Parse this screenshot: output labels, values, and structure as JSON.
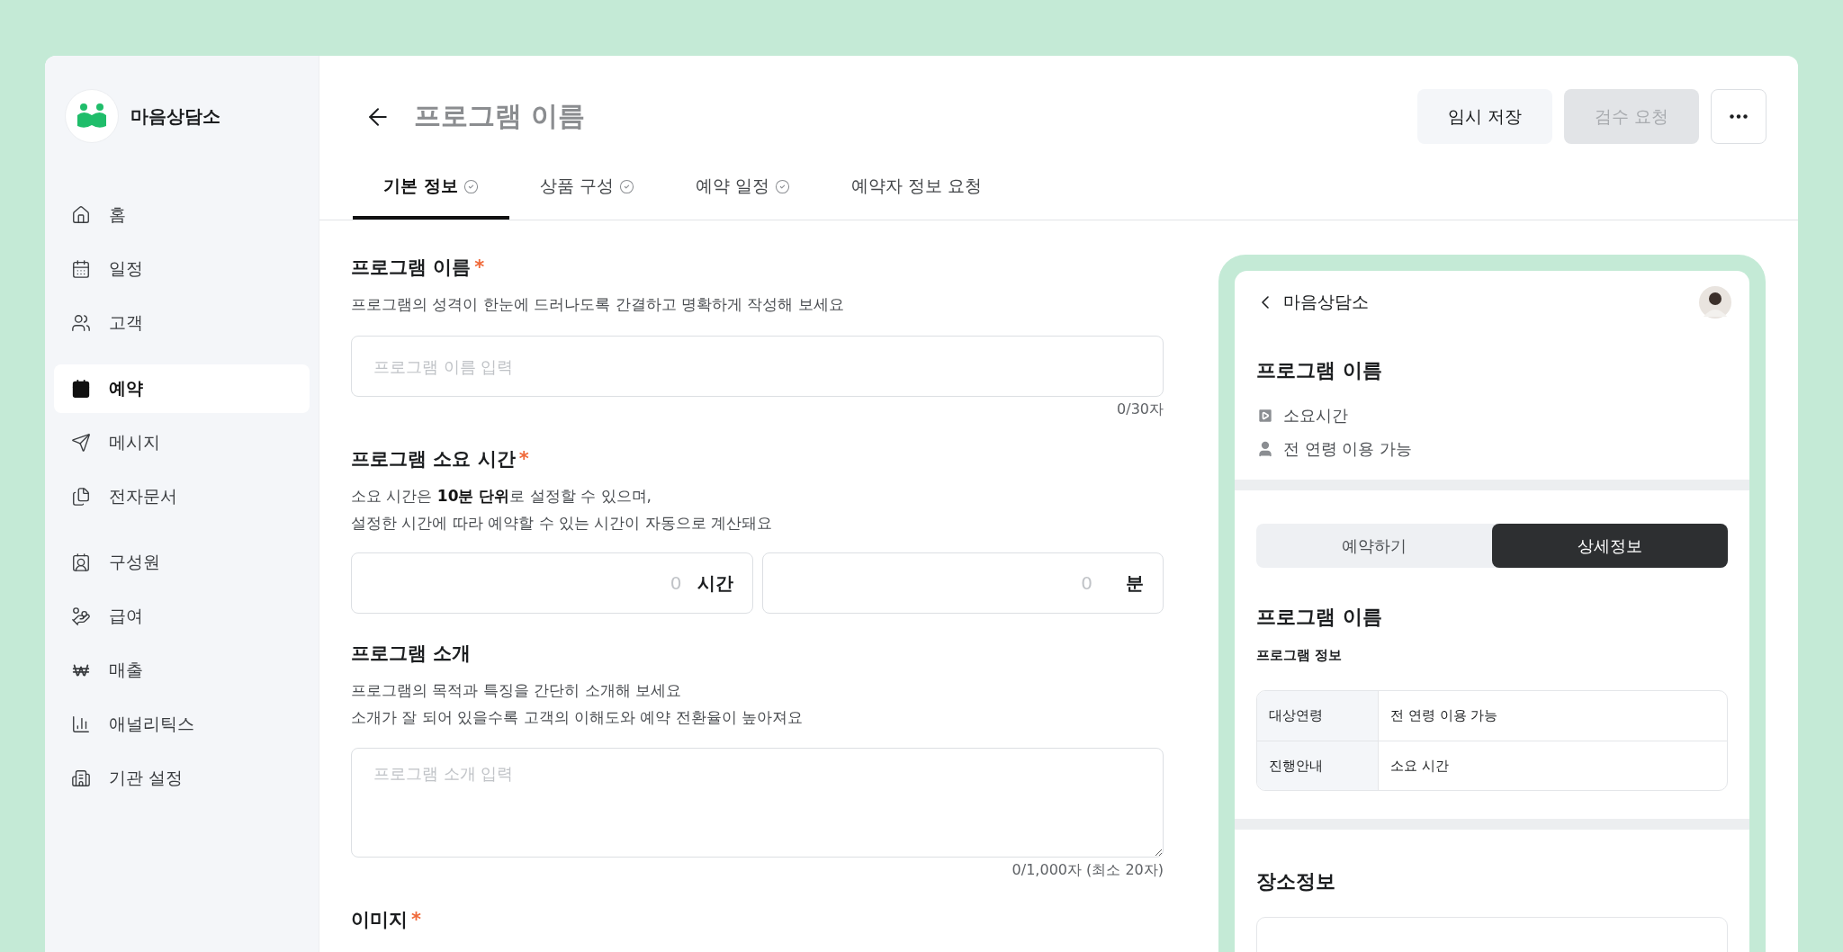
{
  "sidebar": {
    "brand": "마음상담소",
    "groups": [
      [
        {
          "label": "홈",
          "kind": "home",
          "selected": false
        },
        {
          "label": "일정",
          "kind": "schedule",
          "selected": false
        },
        {
          "label": "고객",
          "kind": "clients",
          "selected": false
        }
      ],
      [
        {
          "label": "예약",
          "kind": "booking",
          "selected": true
        },
        {
          "label": "메시지",
          "kind": "message",
          "selected": false
        },
        {
          "label": "전자문서",
          "kind": "documents",
          "selected": false
        }
      ],
      [
        {
          "label": "구성원",
          "kind": "members",
          "selected": false
        },
        {
          "label": "급여",
          "kind": "payroll",
          "selected": false
        },
        {
          "label": "매출",
          "kind": "sales",
          "selected": false
        },
        {
          "label": "애널리틱스",
          "kind": "analytics",
          "selected": false
        },
        {
          "label": "기관 설정",
          "kind": "settings",
          "selected": false
        }
      ]
    ]
  },
  "header": {
    "title": "프로그램 이름",
    "buttons": [
      {
        "label": "임시 저장",
        "disabled": false
      },
      {
        "label": "검수 요청",
        "disabled": true
      }
    ]
  },
  "tabs": [
    {
      "label": "기본 정보",
      "done": true,
      "selected": true
    },
    {
      "label": "상품 구성",
      "done": true,
      "selected": false
    },
    {
      "label": "예약 일정",
      "done": true,
      "selected": false
    },
    {
      "label": "예약자 정보 요청",
      "done": false,
      "selected": false
    }
  ],
  "form": {
    "sections": [
      {
        "kind": "text",
        "label": "프로그램 이름",
        "required_mark": "*",
        "hint": [
          "프로그램의 성격이 한눈에 드러나도록 간결하고 명확하게 작성해 보세요"
        ],
        "placeholder": "프로그램 이름 입력",
        "counter": "0/30자"
      },
      {
        "kind": "duration",
        "label": "프로그램 소요 시간",
        "required_mark": "*",
        "hint": [
          "소요 시간은 **10분 단위**로 설정할 수 있으며,",
          "설정한 시간에 따라 예약할 수 있는 시간이 자동으로 계산돼요"
        ],
        "fields": [
          {
            "placeholder": "0",
            "unit": "시간"
          },
          {
            "placeholder": "0",
            "unit": "분"
          }
        ]
      },
      {
        "kind": "textarea",
        "label": "프로그램 소개",
        "hint": [
          "프로그램의 목적과 특징을 간단히 소개해 보세요",
          "소개가 잘 되어 있을수록 고객의 이해도와 예약 전환율이 높아져요"
        ],
        "placeholder": "프로그램 소개 입력",
        "counter": "0/1,000자 (최소 20자)"
      },
      {
        "kind": "image",
        "label": "이미지",
        "required_mark": "*"
      }
    ]
  },
  "preview": {
    "brand": "마음상담소",
    "title": "프로그램 이름",
    "meta": [
      {
        "kind": "duration",
        "text": "소요시간"
      },
      {
        "kind": "audience",
        "text": "전 연령 이용 가능"
      }
    ],
    "segments": [
      {
        "label": "예약하기",
        "selected": false
      },
      {
        "label": "상세정보",
        "selected": true
      }
    ],
    "detail_title": "프로그램 이름",
    "info_heading": "프로그램 정보",
    "info_rows": [
      {
        "label": "대상연령",
        "value": "전 연령 이용 가능"
      },
      {
        "label": "진행안내",
        "value": "소요 시간"
      }
    ],
    "place_heading": "장소정보"
  }
}
